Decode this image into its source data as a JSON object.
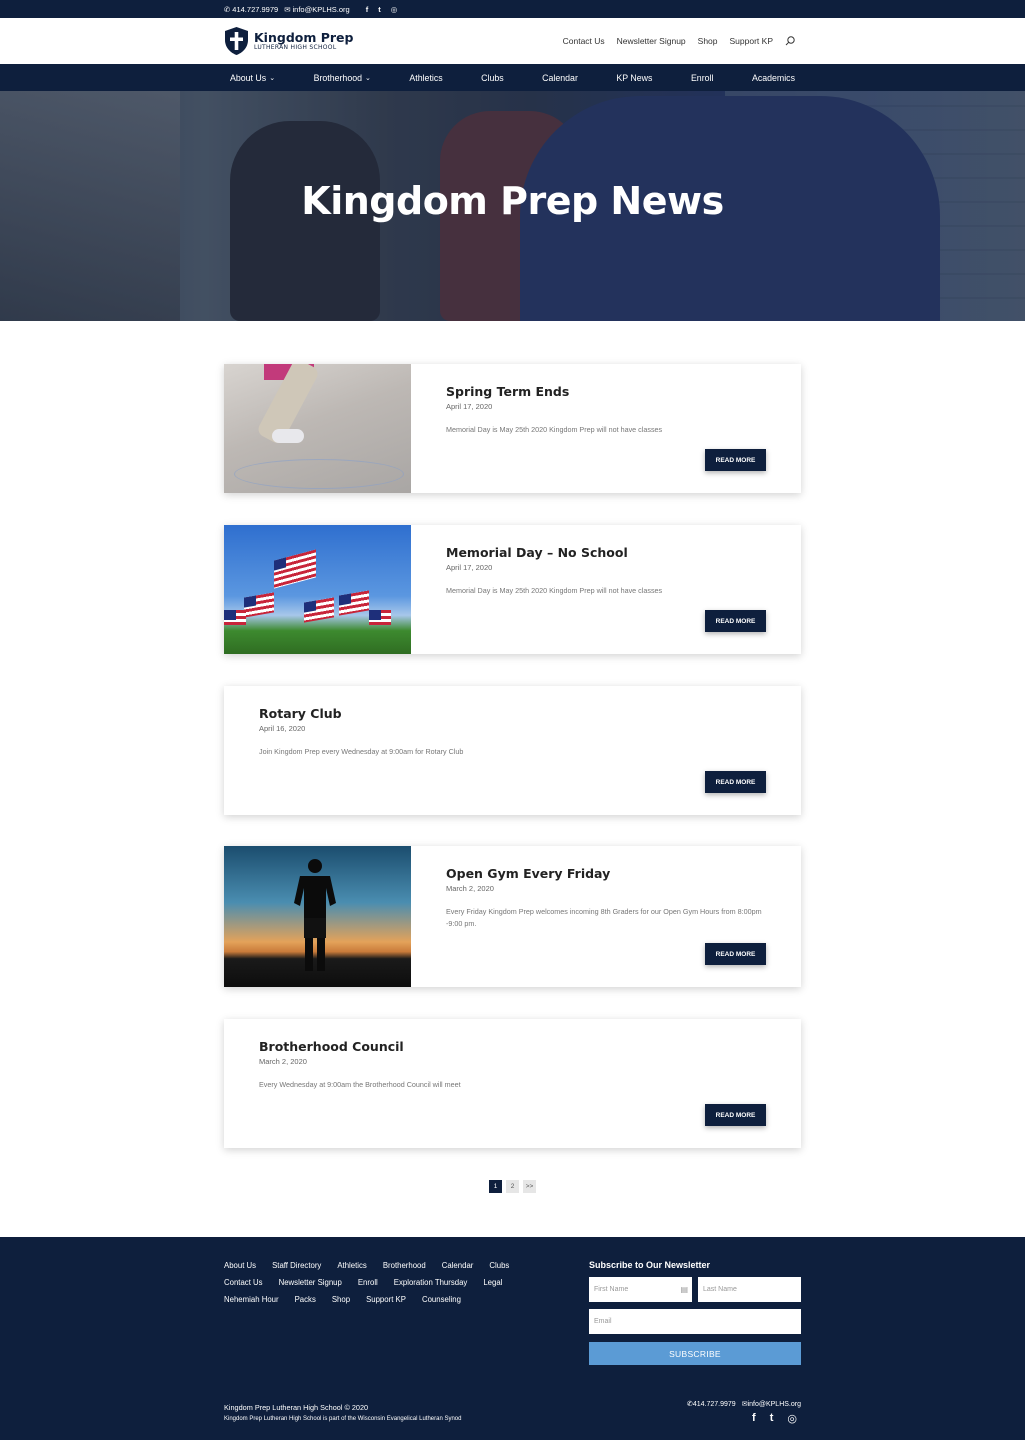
{
  "topbar": {
    "phone": "414.727.9979",
    "email": "info@KPLHS.org",
    "social": [
      {
        "icon": "facebook-icon",
        "glyph": "f"
      },
      {
        "icon": "twitter-icon",
        "glyph": "t"
      },
      {
        "icon": "instagram-icon",
        "glyph": "◎"
      }
    ]
  },
  "header": {
    "logo_name": "Kingdom Prep",
    "logo_sub": "LUTHERAN HIGH SCHOOL",
    "util_links": [
      "Contact Us",
      "Newsletter Signup",
      "Shop",
      "Support KP"
    ]
  },
  "nav": {
    "items": [
      {
        "label": "About Us",
        "dropdown": true
      },
      {
        "label": "Brotherhood",
        "dropdown": true
      },
      {
        "label": "Athletics",
        "dropdown": false
      },
      {
        "label": "Clubs",
        "dropdown": false
      },
      {
        "label": "Calendar",
        "dropdown": false
      },
      {
        "label": "KP News",
        "dropdown": false
      },
      {
        "label": "Enroll",
        "dropdown": false
      },
      {
        "label": "Academics",
        "dropdown": false
      }
    ]
  },
  "hero": {
    "title": "Kingdom Prep News"
  },
  "posts": [
    {
      "title": "Spring Term Ends",
      "date": "April 17, 2020",
      "excerpt": "Memorial Day is May 25th 2020 Kingdom Prep will not have classes",
      "button": "READ MORE",
      "image": "walking-feet"
    },
    {
      "title": "Memorial Day – No School",
      "date": "April 17, 2020",
      "excerpt": "Memorial Day is May 25th 2020 Kingdom Prep will not have classes",
      "button": "READ MORE",
      "image": "american-flags"
    },
    {
      "title": "Rotary Club",
      "date": "April 16, 2020",
      "excerpt": "Join Kingdom Prep every Wednesday at 9:00am for Rotary Club",
      "button": "READ MORE",
      "image": ""
    },
    {
      "title": "Open Gym Every Friday",
      "date": "March 2, 2020",
      "excerpt": "Every Friday Kingdom Prep welcomes incoming 8th Graders for our Open Gym Hours from 8:00pm -9:00 pm.",
      "button": "READ MORE",
      "image": "sunset-silhouette"
    },
    {
      "title": "Brotherhood Council",
      "date": "March 2, 2020",
      "excerpt": "Every Wednesday at 9:00am the Brotherhood Council will meet",
      "button": "READ MORE",
      "image": ""
    }
  ],
  "pagination": {
    "pages": [
      "1",
      "2",
      ">>"
    ],
    "current": "1"
  },
  "footer": {
    "links": [
      "About Us",
      "Staff Directory",
      "Athletics",
      "Brotherhood",
      "Calendar",
      "Clubs",
      "Contact Us",
      "Newsletter Signup",
      "Enroll",
      "Exploration Thursday",
      "Legal",
      "Nehemiah Hour",
      "Packs",
      "Shop",
      "Support KP",
      "Counseling"
    ],
    "newsletter_title": "Subscribe to Our Newsletter",
    "first_name_placeholder": "First Name",
    "last_name_placeholder": "Last Name",
    "email_placeholder": "Email",
    "subscribe_label": "SUBSCRIBE",
    "copyright": "Kingdom Prep Lutheran High School © 2020",
    "synod_note": "Kingdom Prep Lutheran High School is part of the Wisconsin Evangelical Lutheran Synod",
    "phone": "414.727.9979",
    "email": "info@KPLHS.org"
  },
  "colors": {
    "navy": "#0e1f3d",
    "subscribe_blue": "#5b9bd5",
    "white": "#ffffff"
  }
}
